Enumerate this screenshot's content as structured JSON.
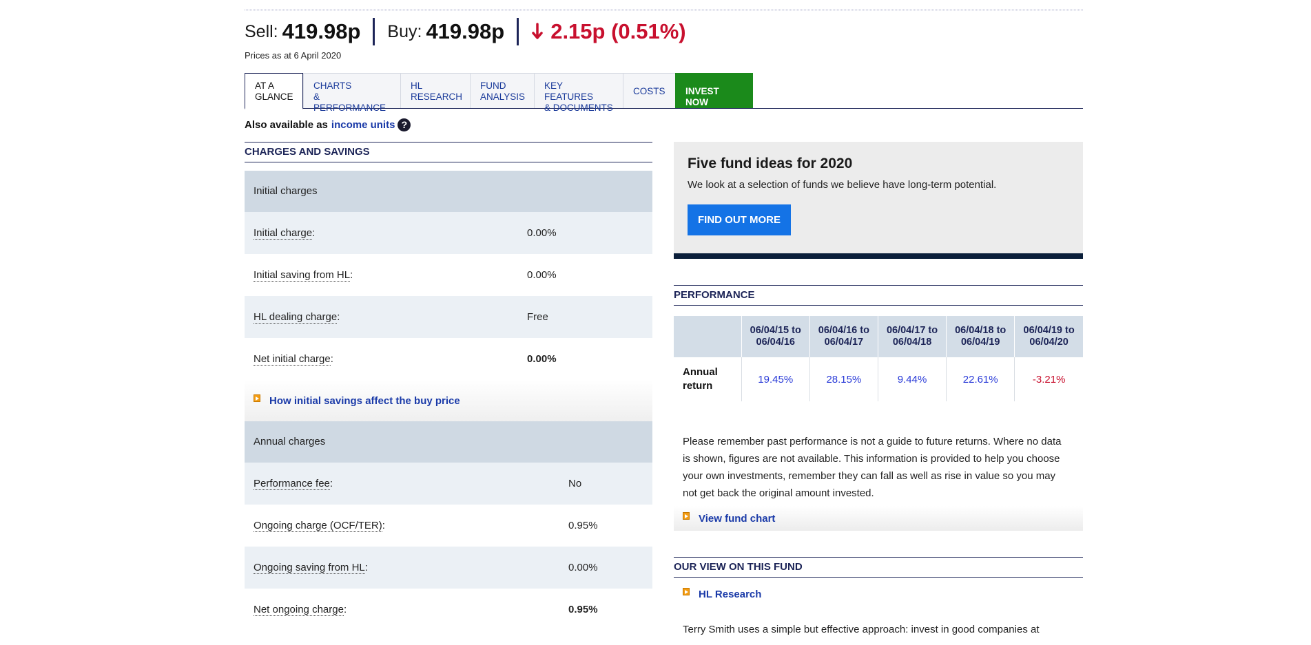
{
  "price": {
    "sell_label": "Sell:",
    "sell_value": "419.98p",
    "buy_label": "Buy:",
    "buy_value": "419.98p",
    "change": "2.15p (0.51%)",
    "change_direction": "down",
    "as_at": "Prices as at 6 April 2020"
  },
  "tabs": [
    {
      "label": "AT A\nGLANCE",
      "active": true
    },
    {
      "label": "CHARTS\n& PERFORMANCE",
      "active": false
    },
    {
      "label": "HL\nRESEARCH",
      "active": false
    },
    {
      "label": "FUND\nANALYSIS",
      "active": false
    },
    {
      "label": "KEY FEATURES\n& DOCUMENTS",
      "active": false
    },
    {
      "label": "COSTS",
      "active": false
    },
    {
      "label": "INVEST NOW",
      "active": false
    }
  ],
  "also_available": {
    "text": "Also available as",
    "link": "income units",
    "help_icon": "?"
  },
  "charges": {
    "title": "CHARGES AND SAVINGS",
    "initial_group": "Initial charges",
    "initial_rows": [
      {
        "label": "Initial charge",
        "value": "0.00%"
      },
      {
        "label": "Initial saving from HL",
        "value": "0.00%"
      },
      {
        "label": "HL dealing charge",
        "value": "Free"
      },
      {
        "label": "Net initial charge",
        "value": "0.00%"
      }
    ],
    "initial_link": "How initial savings affect the buy price",
    "annual_group": "Annual charges",
    "annual_rows": [
      {
        "label": "Performance fee",
        "value": "No"
      },
      {
        "label": "Ongoing charge (OCF/TER)",
        "value": "0.95%"
      },
      {
        "label": "Ongoing saving from HL",
        "value": "0.00%"
      },
      {
        "label": "Net ongoing charge",
        "value": "0.95%"
      }
    ]
  },
  "promo": {
    "title": "Five fund ideas for 2020",
    "text": "We look at a selection of funds we believe have long-term potential.",
    "button": "FIND OUT MORE"
  },
  "performance": {
    "title": "PERFORMANCE",
    "periods": [
      "06/04/15 to 06/04/16",
      "06/04/16 to 06/04/17",
      "06/04/17 to 06/04/18",
      "06/04/18 to 06/04/19",
      "06/04/19 to 06/04/20"
    ],
    "row_label": "Annual return",
    "values": [
      "19.45%",
      "28.15%",
      "9.44%",
      "22.61%",
      "-3.21%"
    ],
    "disclaimer": "Please remember past performance is not a guide to future returns. Where no data is shown, figures are not available. This information is provided to help you choose your own investments, remember they can fall as well as rise in value so you may not get back the original amount invested.",
    "chart_link": "View fund chart"
  },
  "our_view": {
    "title": "OUR VIEW ON THIS FUND",
    "link": "HL Research",
    "text": "Terry Smith uses a simple but effective approach: invest in good companies at"
  },
  "colors": {
    "navy": "#1c2457",
    "link_blue": "#1a3aa8",
    "negative_red": "#c8102e",
    "invest_green": "#1b8a1b",
    "button_blue": "#1473e6"
  }
}
